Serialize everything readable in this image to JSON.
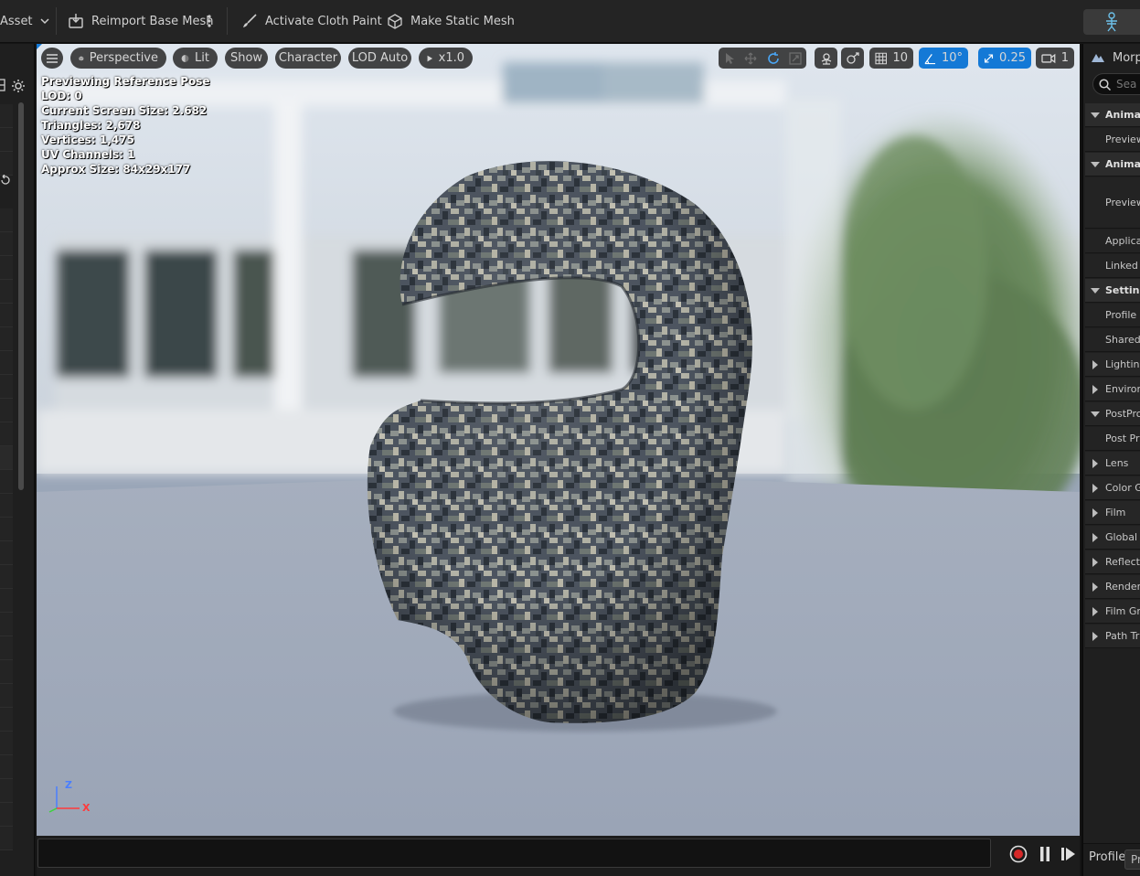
{
  "toolbar": {
    "asset_menu": "Asset",
    "reimport": "Reimport Base Mesh",
    "cloth_paint": "Activate Cloth Paint",
    "static_mesh": "Make Static Mesh"
  },
  "viewport": {
    "perspective": "Perspective",
    "lit": "Lit",
    "show": "Show",
    "character": "Character",
    "lod": "LOD Auto",
    "speed": "x1.0",
    "grid_size": "10",
    "rotation_snap": "10°",
    "scale_snap": "0.25",
    "camera_speed": "1",
    "stats": [
      "Previewing Reference Pose",
      "LOD: 0",
      "Current Screen Size: 2.682",
      "Triangles: 2,678",
      "Vertices: 1,475",
      "UV Channels: 1",
      "Approx Size: 84x29x177"
    ],
    "axis_z": "Z",
    "axis_x": "X"
  },
  "right_panel": {
    "title": "Morph",
    "search_placeholder": "Sea",
    "rows": [
      {
        "label": "Animati",
        "kind": "cat",
        "expanded": true
      },
      {
        "label": "Preview",
        "kind": "prop"
      },
      {
        "label": "Animati",
        "kind": "cat",
        "expanded": true
      },
      {
        "label": "Preview",
        "kind": "prop-tall"
      },
      {
        "label": "Applica",
        "kind": "prop"
      },
      {
        "label": "Linked",
        "kind": "prop"
      },
      {
        "label": "Setting",
        "kind": "cat",
        "expanded": true
      },
      {
        "label": "Profile",
        "kind": "prop"
      },
      {
        "label": "Shared",
        "kind": "prop"
      },
      {
        "label": "Lighting",
        "kind": "sub",
        "expanded": false
      },
      {
        "label": "Environ",
        "kind": "sub",
        "expanded": false
      },
      {
        "label": "PostPro",
        "kind": "sub",
        "expanded": true
      },
      {
        "label": "Post Pr",
        "kind": "prop"
      },
      {
        "label": "Lens",
        "kind": "sub",
        "expanded": false
      },
      {
        "label": "Color G",
        "kind": "sub",
        "expanded": false
      },
      {
        "label": "Film",
        "kind": "sub",
        "expanded": false
      },
      {
        "label": "Global I",
        "kind": "sub",
        "expanded": false
      },
      {
        "label": "Reflect",
        "kind": "sub",
        "expanded": false
      },
      {
        "label": "Render",
        "kind": "sub",
        "expanded": false
      },
      {
        "label": "Film Gr",
        "kind": "sub",
        "expanded": false
      },
      {
        "label": "Path Tr",
        "kind": "sub",
        "expanded": false
      }
    ],
    "profile_label": "Profile",
    "profile_value": "Pr"
  },
  "colors": {
    "accent": "#1479d6",
    "record": "#d62828",
    "axis_z": "#4a7fff",
    "axis_x": "#ff3b3b",
    "axis_y": "#3ad63a"
  }
}
